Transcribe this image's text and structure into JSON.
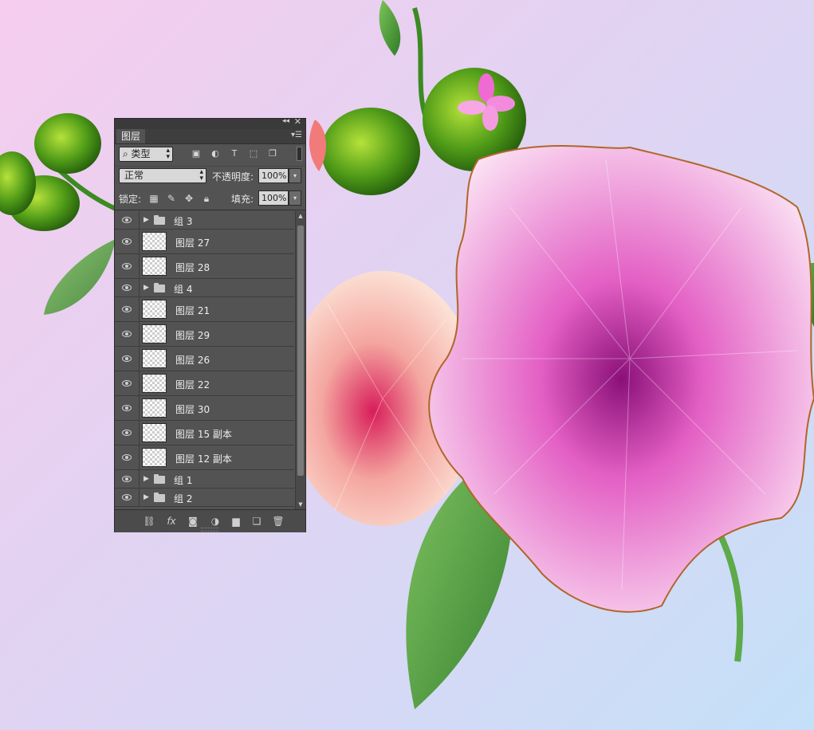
{
  "panel": {
    "tab_label": "图层",
    "filter": {
      "selected": "类型"
    },
    "blend_mode": "正常",
    "opacity_label": "不透明度:",
    "opacity_value": "100%",
    "lock_label": "锁定:",
    "fill_label": "填充:",
    "fill_value": "100%",
    "filter_icons": [
      "image-icon",
      "adjustment-icon",
      "text-icon",
      "shape-icon",
      "smart-object-icon"
    ],
    "lock_icons": [
      "lock-transparent-icon",
      "lock-paint-icon",
      "lock-position-icon",
      "lock-all-icon"
    ],
    "bottom_icons": [
      "link-icon",
      "fx-icon",
      "mask-icon",
      "adjustment-layer-icon",
      "new-group-icon",
      "new-layer-icon",
      "trash-icon"
    ]
  },
  "layers": [
    {
      "type": "group",
      "name": "组 3"
    },
    {
      "type": "layer",
      "name": "图层 27"
    },
    {
      "type": "layer",
      "name": "图层 28"
    },
    {
      "type": "group",
      "name": "组 4"
    },
    {
      "type": "layer",
      "name": "图层 21"
    },
    {
      "type": "layer",
      "name": "图层 29"
    },
    {
      "type": "layer",
      "name": "图层 26"
    },
    {
      "type": "layer",
      "name": "图层 22"
    },
    {
      "type": "layer",
      "name": "图层 30"
    },
    {
      "type": "layer",
      "name": "图层 15 副本"
    },
    {
      "type": "layer",
      "name": "图层 12 副本"
    },
    {
      "type": "group",
      "name": "组 1"
    },
    {
      "type": "group",
      "name": "组 2"
    }
  ],
  "colors": {
    "panel_bg": "#535353",
    "canvas_gradient_start": "#f6cdee",
    "canvas_gradient_end": "#c4e0f8",
    "petal_pink": "#e35fc4",
    "leaf_green": "#3f9a2b"
  }
}
